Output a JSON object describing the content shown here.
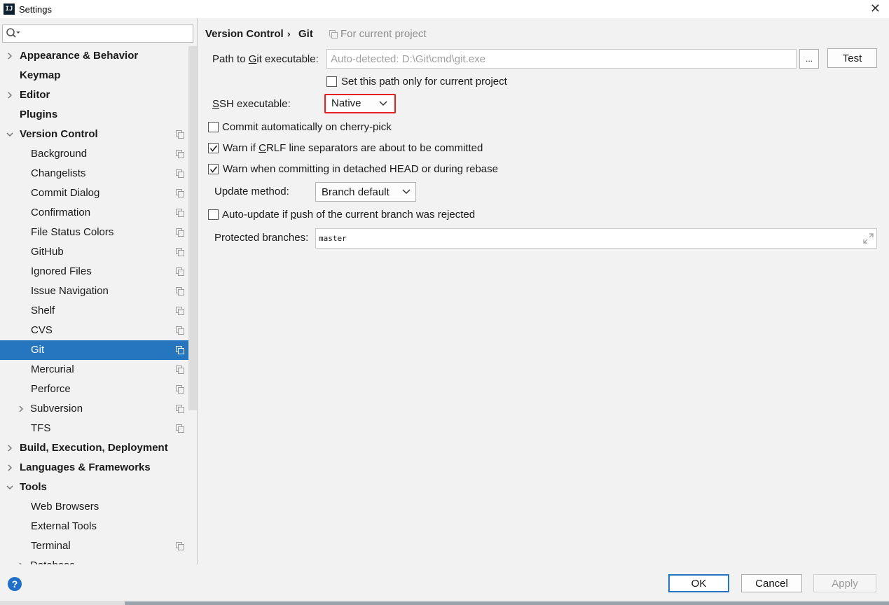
{
  "window": {
    "title": "Settings",
    "app_icon": "IJ"
  },
  "search": {
    "placeholder": ""
  },
  "tree": [
    {
      "label": "Appearance & Behavior",
      "level": 1,
      "bold": true,
      "expand": "collapsed",
      "project_icon": false
    },
    {
      "label": "Keymap",
      "level": 1,
      "bold": true,
      "expand": "none",
      "project_icon": false
    },
    {
      "label": "Editor",
      "level": 1,
      "bold": true,
      "expand": "collapsed",
      "project_icon": false
    },
    {
      "label": "Plugins",
      "level": 1,
      "bold": true,
      "expand": "none",
      "project_icon": false
    },
    {
      "label": "Version Control",
      "level": 1,
      "bold": true,
      "expand": "expanded",
      "project_icon": true
    },
    {
      "label": "Background",
      "level": 2,
      "bold": false,
      "expand": "none",
      "project_icon": true
    },
    {
      "label": "Changelists",
      "level": 2,
      "bold": false,
      "expand": "none",
      "project_icon": true
    },
    {
      "label": "Commit Dialog",
      "level": 2,
      "bold": false,
      "expand": "none",
      "project_icon": true
    },
    {
      "label": "Confirmation",
      "level": 2,
      "bold": false,
      "expand": "none",
      "project_icon": true
    },
    {
      "label": "File Status Colors",
      "level": 2,
      "bold": false,
      "expand": "none",
      "project_icon": true
    },
    {
      "label": "GitHub",
      "level": 2,
      "bold": false,
      "expand": "none",
      "project_icon": true
    },
    {
      "label": "Ignored Files",
      "level": 2,
      "bold": false,
      "expand": "none",
      "project_icon": true
    },
    {
      "label": "Issue Navigation",
      "level": 2,
      "bold": false,
      "expand": "none",
      "project_icon": true
    },
    {
      "label": "Shelf",
      "level": 2,
      "bold": false,
      "expand": "none",
      "project_icon": true
    },
    {
      "label": "CVS",
      "level": 2,
      "bold": false,
      "expand": "none",
      "project_icon": true
    },
    {
      "label": "Git",
      "level": 2,
      "bold": false,
      "expand": "none",
      "project_icon": true,
      "selected": true
    },
    {
      "label": "Mercurial",
      "level": 2,
      "bold": false,
      "expand": "none",
      "project_icon": true
    },
    {
      "label": "Perforce",
      "level": 2,
      "bold": false,
      "expand": "none",
      "project_icon": true
    },
    {
      "label": "Subversion",
      "level": 2,
      "bold": false,
      "expand": "collapsed",
      "project_icon": true
    },
    {
      "label": "TFS",
      "level": 2,
      "bold": false,
      "expand": "none",
      "project_icon": true
    },
    {
      "label": "Build, Execution, Deployment",
      "level": 1,
      "bold": true,
      "expand": "collapsed",
      "project_icon": false
    },
    {
      "label": "Languages & Frameworks",
      "level": 1,
      "bold": true,
      "expand": "collapsed",
      "project_icon": false
    },
    {
      "label": "Tools",
      "level": 1,
      "bold": true,
      "expand": "expanded",
      "project_icon": false
    },
    {
      "label": "Web Browsers",
      "level": 2,
      "bold": false,
      "expand": "none",
      "project_icon": false
    },
    {
      "label": "External Tools",
      "level": 2,
      "bold": false,
      "expand": "none",
      "project_icon": false
    },
    {
      "label": "Terminal",
      "level": 2,
      "bold": false,
      "expand": "none",
      "project_icon": true
    },
    {
      "label": "Database",
      "level": 2,
      "bold": false,
      "expand": "collapsed",
      "project_icon": false
    }
  ],
  "breadcrumb": {
    "parent": "Version Control",
    "separator": "›",
    "current": "Git",
    "scope": "For current project"
  },
  "git": {
    "path_label_pre": "Path to ",
    "path_label_ul": "G",
    "path_label_post": "it executable:",
    "path_placeholder": "Auto-detected: D:\\Git\\cmd\\git.exe",
    "browse_label": "...",
    "test_label": "Test",
    "set_path_label": "Set this path only for current project",
    "set_path_checked": false,
    "ssh_label_ul": "S",
    "ssh_label_post": "SH executable:",
    "ssh_value": "Native",
    "cherry_pick_label": "Commit automatically on cherry-pick",
    "cherry_pick_checked": false,
    "crlf_label_pre": "Warn if ",
    "crlf_label_ul": "C",
    "crlf_label_post": "RLF line separators are about to be committed",
    "crlf_checked": true,
    "detached_label": "Warn when committing in detached HEAD or during rebase",
    "detached_checked": true,
    "update_method_label": "Update method:",
    "update_method_value": "Branch default",
    "auto_update_label_pre": "Auto-update if ",
    "auto_update_label_ul": "p",
    "auto_update_label_post": "ush of the current branch was rejected",
    "auto_update_checked": false,
    "protected_label": "Protected branches:",
    "protected_value": "master"
  },
  "footer": {
    "help": "?",
    "ok": "OK",
    "cancel": "Cancel",
    "apply": "Apply"
  },
  "colors": {
    "selection": "#2675bf",
    "highlight_frame": "#e62020",
    "help_icon": "#1f6fc9"
  }
}
